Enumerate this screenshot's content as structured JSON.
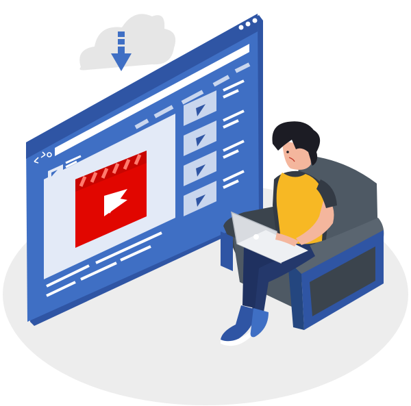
{
  "illustration": {
    "colors": {
      "primary_blue": "#3f6fc4",
      "dark_blue": "#2f55a4",
      "light_blue": "#c9d6ee",
      "pale_blue": "#e3eaf7",
      "video_red": "#e10600",
      "sofa": "#4e5964",
      "sofa_dark": "#3b444d",
      "shirt": "#f7b824",
      "ground": "#ededed"
    },
    "icons": [
      "download-cloud-icon",
      "play-icon",
      "browser-nav-icons",
      "laptop-icon",
      "sneaker-icon"
    ]
  }
}
